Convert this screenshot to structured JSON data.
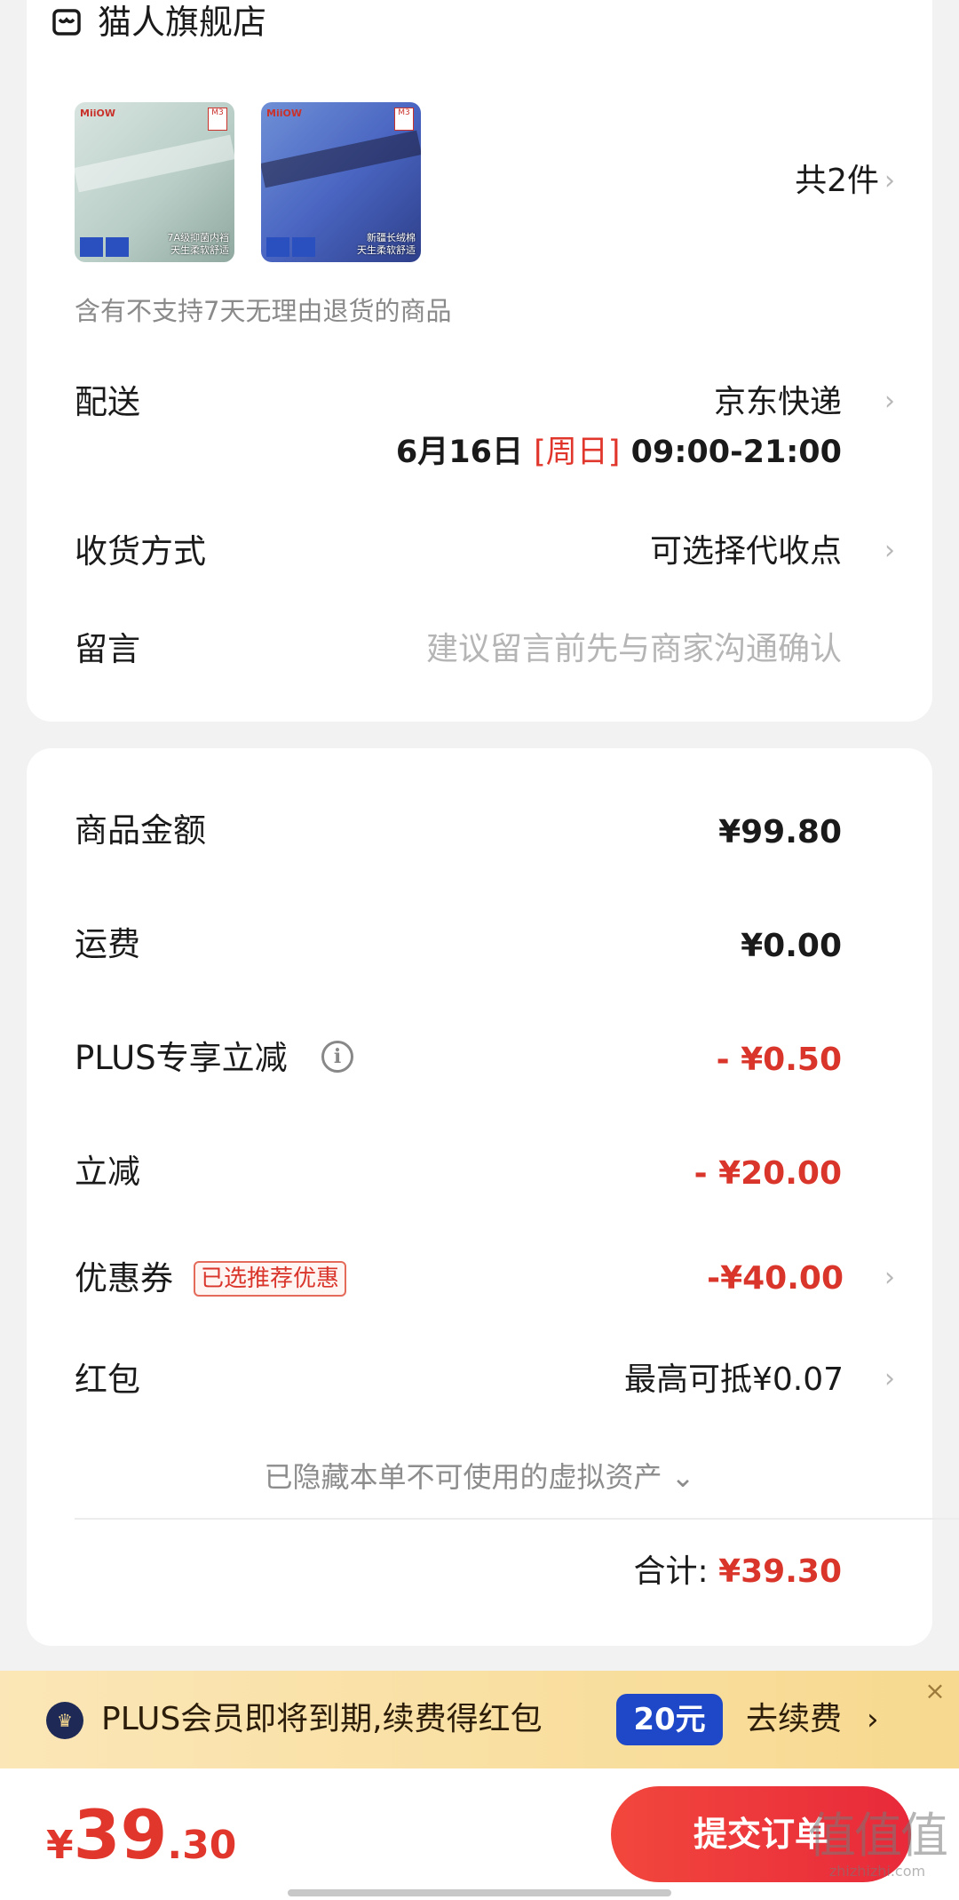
{
  "store": {
    "name": "猫人旗舰店",
    "icon": "store-icon"
  },
  "products": {
    "items": [
      {
        "brand": "MiiOW",
        "badge": "M3",
        "caption_line1": "7A级抑菌内裆",
        "caption_line2": "天生柔软舒适",
        "color": "#b9cec7"
      },
      {
        "brand": "MiiOW",
        "badge": "M3",
        "caption_line1": "新疆长绒棉",
        "caption_line2": "天生柔软舒适",
        "color": "#4a66c2"
      }
    ],
    "count": "共2件"
  },
  "notice": "含有不支持7天无理由退货的商品",
  "delivery": {
    "label": "配送",
    "carrier": "京东快递",
    "date": "6月16日",
    "weekday": "[周日]",
    "time": "09:00-21:00"
  },
  "receive": {
    "label": "收货方式",
    "value": "可选择代收点"
  },
  "message": {
    "label": "留言",
    "placeholder": "建议留言前先与商家沟通确认"
  },
  "fees": {
    "goods": {
      "label": "商品金额",
      "value": "¥99.80"
    },
    "shipping": {
      "label": "运费",
      "value": "¥0.00"
    },
    "plus": {
      "label": "PLUS专享立减",
      "value": "- ¥0.50"
    },
    "instant": {
      "label": "立减",
      "value": "- ¥20.00"
    },
    "coupon": {
      "label": "优惠券",
      "tag": "已选推荐优惠",
      "value": "-¥40.00"
    },
    "redpacket": {
      "label": "红包",
      "value": "最高可抵¥0.07"
    }
  },
  "hidden_assets": "已隐藏本单不可使用的虚拟资产 ⌄",
  "total": {
    "label": "合计:",
    "value": "¥39.30"
  },
  "plus_banner": {
    "text": "PLUS会员即将到期,续费得红包",
    "badge": "20元",
    "action": "去续费",
    "chevron": "›",
    "close": "×"
  },
  "bottom": {
    "currency": "¥",
    "amount_int": "39",
    "amount_dec": ".30",
    "submit": "提交订单"
  },
  "watermark": {
    "main": "值值值",
    "sub": "zhizhizhi.com"
  },
  "colors": {
    "accent_red": "#d9352b",
    "plus_blue": "#1e48c7",
    "plus_bg": "#f7d98f"
  }
}
